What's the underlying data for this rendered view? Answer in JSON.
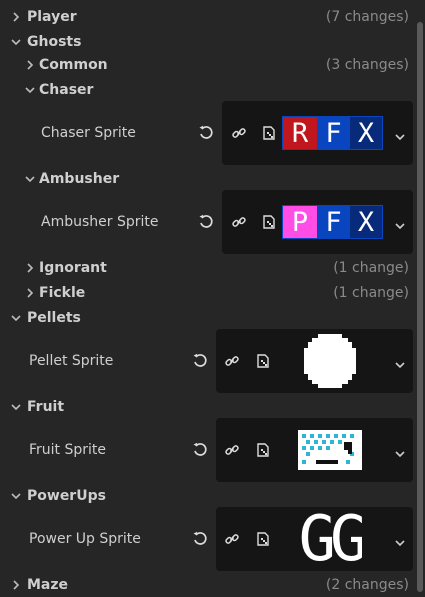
{
  "sections": {
    "player": {
      "label": "Player",
      "changes": "(7 changes)"
    },
    "ghosts": {
      "label": "Ghosts"
    },
    "common": {
      "label": "Common",
      "changes": "(3 changes)"
    },
    "chaser": {
      "label": "Chaser",
      "prop_label": "Chaser Sprite"
    },
    "ambusher": {
      "label": "Ambusher",
      "prop_label": "Ambusher Sprite"
    },
    "ignorant": {
      "label": "Ignorant",
      "changes": "(1 change)"
    },
    "fickle": {
      "label": "Fickle",
      "changes": "(1 change)"
    },
    "pellets": {
      "label": "Pellets",
      "prop_label": "Pellet Sprite"
    },
    "fruit": {
      "label": "Fruit",
      "prop_label": "Fruit Sprite"
    },
    "powerups": {
      "label": "PowerUps",
      "prop_label": "Power Up Sprite"
    },
    "maze": {
      "label": "Maze",
      "changes": "(2 changes)"
    }
  },
  "sprites": {
    "chaser": [
      "R",
      "F",
      "X"
    ],
    "ambusher": [
      "P",
      "F",
      "X"
    ],
    "powerup": "GG"
  },
  "icons": {
    "reset": "reset-icon",
    "link": "link-icon",
    "edit": "edit-sprite-icon",
    "dropdown": "chevron-down-icon"
  },
  "colors": {
    "red": "#c0161e",
    "blue": "#0a45c0",
    "pink": "#ff4de6",
    "navy": "#082a7a"
  }
}
